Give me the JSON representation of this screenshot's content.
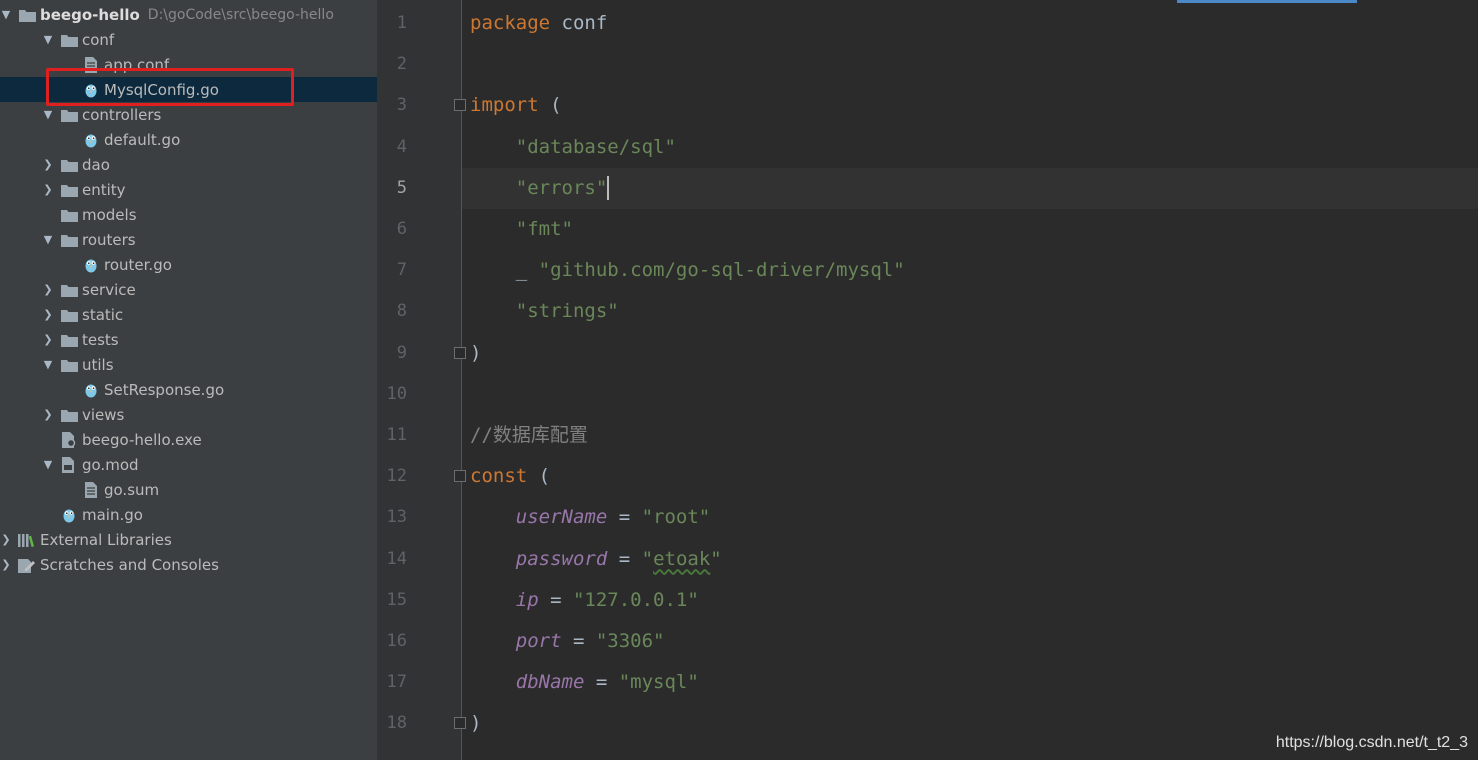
{
  "project": {
    "name": "beego-hello",
    "path": "D:\\goCode\\src\\beego-hello",
    "tree": [
      {
        "label": "conf",
        "depth": 1,
        "expanded": true,
        "icon": "folder-icon"
      },
      {
        "label": "app.conf",
        "depth": 2,
        "icon": "file-text-icon"
      },
      {
        "label": "MysqlConfig.go",
        "depth": 2,
        "icon": "go-file-icon",
        "selected": true
      },
      {
        "label": "controllers",
        "depth": 1,
        "expanded": true,
        "icon": "folder-icon"
      },
      {
        "label": "default.go",
        "depth": 2,
        "icon": "go-file-icon"
      },
      {
        "label": "dao",
        "depth": 1,
        "expanded": false,
        "icon": "folder-icon"
      },
      {
        "label": "entity",
        "depth": 1,
        "expanded": false,
        "icon": "folder-icon"
      },
      {
        "label": "models",
        "depth": 1,
        "icon": "folder-icon"
      },
      {
        "label": "routers",
        "depth": 1,
        "expanded": true,
        "icon": "folder-icon"
      },
      {
        "label": "router.go",
        "depth": 2,
        "icon": "go-file-icon"
      },
      {
        "label": "service",
        "depth": 1,
        "expanded": false,
        "icon": "folder-icon"
      },
      {
        "label": "static",
        "depth": 1,
        "expanded": false,
        "icon": "folder-icon"
      },
      {
        "label": "tests",
        "depth": 1,
        "expanded": false,
        "icon": "folder-icon"
      },
      {
        "label": "utils",
        "depth": 1,
        "expanded": true,
        "icon": "folder-icon"
      },
      {
        "label": "SetResponse.go",
        "depth": 2,
        "icon": "go-file-icon"
      },
      {
        "label": "views",
        "depth": 1,
        "expanded": false,
        "icon": "folder-icon"
      },
      {
        "label": "beego-hello.exe",
        "depth": 1,
        "icon": "exe-file-icon"
      },
      {
        "label": "go.mod",
        "depth": 1,
        "expanded": true,
        "icon": "go-mod-icon"
      },
      {
        "label": "go.sum",
        "depth": 2,
        "icon": "file-text-icon"
      },
      {
        "label": "main.go",
        "depth": 1,
        "icon": "go-file-icon"
      },
      {
        "label": "External Libraries",
        "depth": 0,
        "expanded": false,
        "icon": "library-icon"
      },
      {
        "label": "Scratches and Consoles",
        "depth": 0,
        "expanded": false,
        "icon": "scratches-icon"
      }
    ]
  },
  "editor": {
    "current_line": 5,
    "lines": [
      {
        "n": "1",
        "tokens": [
          {
            "t": "kw",
            "v": "package"
          },
          {
            "t": "plain",
            "v": " conf"
          }
        ]
      },
      {
        "n": "2",
        "tokens": []
      },
      {
        "n": "3",
        "tokens": [
          {
            "t": "kw",
            "v": "import"
          },
          {
            "t": "plain",
            "v": " ("
          }
        ]
      },
      {
        "n": "4",
        "tokens": [
          {
            "t": "plain",
            "v": "    "
          },
          {
            "t": "str",
            "v": "\"database/sql\""
          }
        ]
      },
      {
        "n": "5",
        "tokens": [
          {
            "t": "plain",
            "v": "    "
          },
          {
            "t": "str",
            "v": "\"errors\""
          }
        ]
      },
      {
        "n": "6",
        "tokens": [
          {
            "t": "plain",
            "v": "    "
          },
          {
            "t": "str",
            "v": "\"fmt\""
          }
        ]
      },
      {
        "n": "7",
        "tokens": [
          {
            "t": "plain",
            "v": "    _ "
          },
          {
            "t": "str",
            "v": "\"github.com/go-sql-driver/mysql\""
          }
        ]
      },
      {
        "n": "8",
        "tokens": [
          {
            "t": "plain",
            "v": "    "
          },
          {
            "t": "str",
            "v": "\"strings\""
          }
        ]
      },
      {
        "n": "9",
        "tokens": [
          {
            "t": "plain",
            "v": ")"
          }
        ]
      },
      {
        "n": "10",
        "tokens": []
      },
      {
        "n": "11",
        "tokens": [
          {
            "t": "cmt",
            "v": "//数据库配置"
          }
        ]
      },
      {
        "n": "12",
        "tokens": [
          {
            "t": "kw",
            "v": "const"
          },
          {
            "t": "plain",
            "v": " ("
          }
        ]
      },
      {
        "n": "13",
        "tokens": [
          {
            "t": "plain",
            "v": "    "
          },
          {
            "t": "var",
            "v": "userName"
          },
          {
            "t": "plain",
            "v": " = "
          },
          {
            "t": "str",
            "v": "\"root\""
          }
        ]
      },
      {
        "n": "14",
        "tokens": [
          {
            "t": "plain",
            "v": "    "
          },
          {
            "t": "var",
            "v": "password"
          },
          {
            "t": "plain",
            "v": " = "
          },
          {
            "t": "str",
            "v": "\""
          },
          {
            "t": "str typo",
            "v": "etoak"
          },
          {
            "t": "str",
            "v": "\""
          }
        ]
      },
      {
        "n": "15",
        "tokens": [
          {
            "t": "plain",
            "v": "    "
          },
          {
            "t": "var",
            "v": "ip"
          },
          {
            "t": "plain",
            "v": " = "
          },
          {
            "t": "str",
            "v": "\"127.0.0.1\""
          }
        ]
      },
      {
        "n": "16",
        "tokens": [
          {
            "t": "plain",
            "v": "    "
          },
          {
            "t": "var",
            "v": "port"
          },
          {
            "t": "plain",
            "v": " = "
          },
          {
            "t": "str",
            "v": "\"3306\""
          }
        ]
      },
      {
        "n": "17",
        "tokens": [
          {
            "t": "plain",
            "v": "    "
          },
          {
            "t": "var",
            "v": "dbName"
          },
          {
            "t": "plain",
            "v": " = "
          },
          {
            "t": "str",
            "v": "\"mysql\""
          }
        ]
      },
      {
        "n": "18",
        "tokens": [
          {
            "t": "plain",
            "v": ")"
          }
        ]
      }
    ],
    "fold_lines": [
      "3",
      "9",
      "12",
      "18"
    ]
  },
  "watermark": "https://blog.csdn.net/t_t2_3",
  "colors": {
    "keyword": "#cc7832",
    "string": "#6a8759",
    "constant": "#9876aa",
    "comment": "#808080",
    "highlight_box": "#e02020"
  }
}
